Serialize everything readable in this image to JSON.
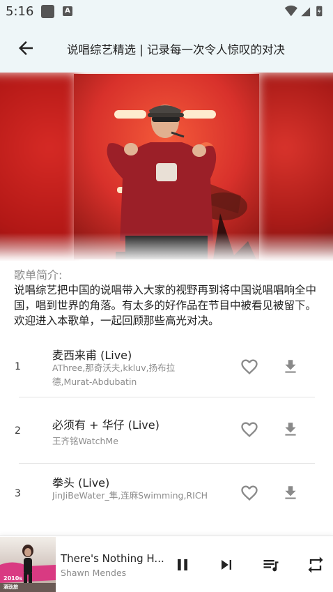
{
  "status_bar": {
    "time": "5:16",
    "app_icon_letter": "A",
    "icons": [
      "square-notification-icon",
      "app-notification-icon",
      "wifi-icon",
      "signal-icon",
      "battery-icon"
    ]
  },
  "header": {
    "title": "说唱综艺精选 | 记录每一次令人惊叹的对决",
    "back_icon": "arrow-left-icon"
  },
  "playlist": {
    "intro_heading": "歌单简介:",
    "intro_text": "说唱综艺把中国的说唱带入大家的视野再到将中国说唱唱响全中国，唱到世界的角落。有太多的好作品在节目中被看见被留下。欢迎进入本歌单，一起回顾那些高光对决。",
    "cover_icon": "rapper-performing-image",
    "accent_color": "#d8312b"
  },
  "songs": [
    {
      "index": "1",
      "title": "麦西来甫 (Live)",
      "artist": "AThree,那奇沃夫,kkluv,扬布拉德,Murat-Abdubatin"
    },
    {
      "index": "2",
      "title": "必须有 + 华仔 (Live)",
      "artist": "王齐铭WatchMe"
    },
    {
      "index": "3",
      "title": "拳头 (Live)",
      "artist": "JinJiBeWater_隼,连麻Swimming,RICH"
    }
  ],
  "player": {
    "title": "There's Nothing H...",
    "artist": "Shawn Mendes",
    "cover_caption_line1": "2010s",
    "cover_caption_line2": "酒劲旅",
    "controls": [
      "pause-icon",
      "skip-next-icon",
      "queue-music-icon",
      "repeat-icon"
    ]
  }
}
